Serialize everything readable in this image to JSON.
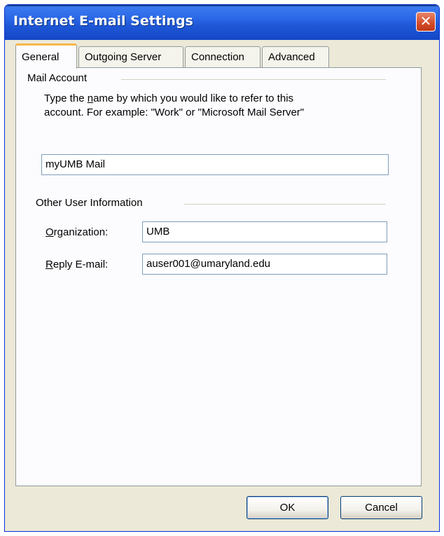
{
  "window": {
    "title": "Internet E-mail Settings",
    "close_glyph": "✕"
  },
  "tabs": [
    {
      "label": "General",
      "active": true
    },
    {
      "label": "Outgoing Server",
      "active": false
    },
    {
      "label": "Connection",
      "active": false
    },
    {
      "label": "Advanced",
      "active": false
    }
  ],
  "mail_account": {
    "group_label": "Mail Account",
    "desc_line1_pre": "Type the ",
    "desc_line1_accel": "n",
    "desc_line1_post": "ame by which you would like to refer to this",
    "desc_line2": "account.  For example: \"Work\" or \"Microsoft Mail Server\"",
    "account_name_value": "myUMB Mail"
  },
  "user_info": {
    "group_label": "Other User Information",
    "org_label_accel": "O",
    "org_label_rest": "rganization:",
    "org_value": "UMB",
    "reply_label_accel": "R",
    "reply_label_rest": "eply E-mail:",
    "reply_value": "auser001@umaryland.edu"
  },
  "buttons": {
    "ok": "OK",
    "cancel": "Cancel"
  },
  "colors": {
    "titlebar": "#2a66e6",
    "close_button": "#d24b28",
    "dialog_bg": "#ece9d8",
    "active_tab_accent": "#f7b64a"
  }
}
